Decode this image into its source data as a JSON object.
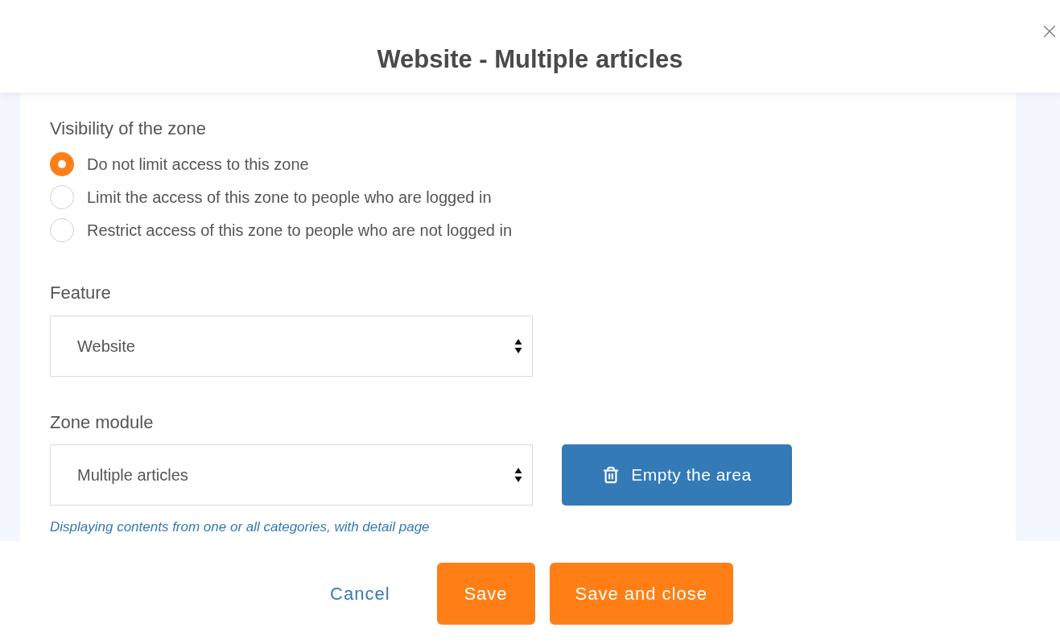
{
  "dialog": {
    "title": "Website - Multiple articles"
  },
  "visibility": {
    "label": "Visibility of the zone",
    "options": [
      {
        "label": "Do not limit access to this zone",
        "selected": true
      },
      {
        "label": "Limit the access of this zone to people who are logged in",
        "selected": false
      },
      {
        "label": "Restrict access of this zone to people who are not logged in",
        "selected": false
      }
    ]
  },
  "feature": {
    "label": "Feature",
    "value": "Website"
  },
  "zone_module": {
    "label": "Zone module",
    "value": "Multiple articles",
    "button": "Empty the area",
    "hint": "Displaying contents from one or all categories, with detail page"
  },
  "footer": {
    "buttons": [
      {
        "label": "Cancel",
        "kind": "link"
      },
      {
        "label": "Save",
        "kind": "primary"
      },
      {
        "label": "Save and close",
        "kind": "primary"
      }
    ]
  }
}
